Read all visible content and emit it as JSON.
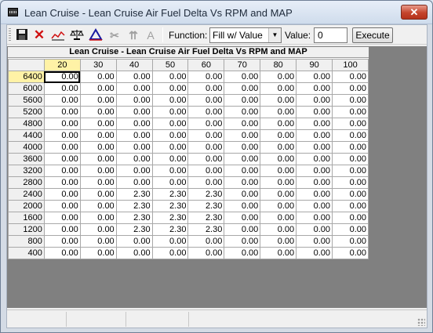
{
  "window": {
    "title": "Lean Cruise - Lean Cruise Air Fuel Delta Vs RPM and MAP"
  },
  "toolbar": {
    "function_label": "Function:",
    "function_value": "Fill w/ Value",
    "value_label": "Value:",
    "value_input": "0",
    "execute_label": "Execute",
    "icons": [
      "save-icon",
      "delete-icon",
      "graph-icon",
      "balance-icon",
      "smooth-icon",
      "cut-icon",
      "interpolate-icon",
      "text-icon"
    ]
  },
  "table": {
    "title": "Lean Cruise - Lean Cruise Air Fuel Delta Vs RPM and MAP",
    "columns": [
      "20",
      "30",
      "40",
      "50",
      "60",
      "70",
      "80",
      "90",
      "100"
    ],
    "selected_column": "20",
    "selected_row": "6400",
    "rows": [
      {
        "rpm": "6400",
        "values": [
          "0.00",
          "0.00",
          "0.00",
          "0.00",
          "0.00",
          "0.00",
          "0.00",
          "0.00",
          "0.00"
        ]
      },
      {
        "rpm": "6000",
        "values": [
          "0.00",
          "0.00",
          "0.00",
          "0.00",
          "0.00",
          "0.00",
          "0.00",
          "0.00",
          "0.00"
        ]
      },
      {
        "rpm": "5600",
        "values": [
          "0.00",
          "0.00",
          "0.00",
          "0.00",
          "0.00",
          "0.00",
          "0.00",
          "0.00",
          "0.00"
        ]
      },
      {
        "rpm": "5200",
        "values": [
          "0.00",
          "0.00",
          "0.00",
          "0.00",
          "0.00",
          "0.00",
          "0.00",
          "0.00",
          "0.00"
        ]
      },
      {
        "rpm": "4800",
        "values": [
          "0.00",
          "0.00",
          "0.00",
          "0.00",
          "0.00",
          "0.00",
          "0.00",
          "0.00",
          "0.00"
        ]
      },
      {
        "rpm": "4400",
        "values": [
          "0.00",
          "0.00",
          "0.00",
          "0.00",
          "0.00",
          "0.00",
          "0.00",
          "0.00",
          "0.00"
        ]
      },
      {
        "rpm": "4000",
        "values": [
          "0.00",
          "0.00",
          "0.00",
          "0.00",
          "0.00",
          "0.00",
          "0.00",
          "0.00",
          "0.00"
        ]
      },
      {
        "rpm": "3600",
        "values": [
          "0.00",
          "0.00",
          "0.00",
          "0.00",
          "0.00",
          "0.00",
          "0.00",
          "0.00",
          "0.00"
        ]
      },
      {
        "rpm": "3200",
        "values": [
          "0.00",
          "0.00",
          "0.00",
          "0.00",
          "0.00",
          "0.00",
          "0.00",
          "0.00",
          "0.00"
        ]
      },
      {
        "rpm": "2800",
        "values": [
          "0.00",
          "0.00",
          "0.00",
          "0.00",
          "0.00",
          "0.00",
          "0.00",
          "0.00",
          "0.00"
        ]
      },
      {
        "rpm": "2400",
        "values": [
          "0.00",
          "0.00",
          "2.30",
          "2.30",
          "2.30",
          "0.00",
          "0.00",
          "0.00",
          "0.00"
        ]
      },
      {
        "rpm": "2000",
        "values": [
          "0.00",
          "0.00",
          "2.30",
          "2.30",
          "2.30",
          "0.00",
          "0.00",
          "0.00",
          "0.00"
        ]
      },
      {
        "rpm": "1600",
        "values": [
          "0.00",
          "0.00",
          "2.30",
          "2.30",
          "2.30",
          "0.00",
          "0.00",
          "0.00",
          "0.00"
        ]
      },
      {
        "rpm": "1200",
        "values": [
          "0.00",
          "0.00",
          "2.30",
          "2.30",
          "2.30",
          "0.00",
          "0.00",
          "0.00",
          "0.00"
        ]
      },
      {
        "rpm": "800",
        "values": [
          "0.00",
          "0.00",
          "0.00",
          "0.00",
          "0.00",
          "0.00",
          "0.00",
          "0.00",
          "0.00"
        ]
      },
      {
        "rpm": "400",
        "values": [
          "0.00",
          "0.00",
          "0.00",
          "0.00",
          "0.00",
          "0.00",
          "0.00",
          "0.00",
          "0.00"
        ]
      }
    ]
  }
}
